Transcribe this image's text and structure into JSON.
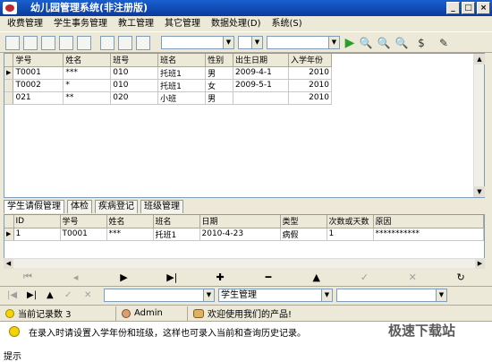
{
  "window": {
    "title": "幼儿园管理系统(非注册版)"
  },
  "menu": [
    {
      "label": "收费管理"
    },
    {
      "label": "学生事务管理"
    },
    {
      "label": "教工管理"
    },
    {
      "label": "其它管理"
    },
    {
      "label": "数据处理(D)"
    },
    {
      "label": "系统(S)"
    }
  ],
  "grid_main": {
    "headers": [
      "学号",
      "姓名",
      "班号",
      "班名",
      "性别",
      "出生日期",
      "入学年份"
    ],
    "rows": [
      {
        "xh": "T0001",
        "xm": "***",
        "bh": "010",
        "bm": "托班1",
        "xb": "男",
        "csrq": "2009-4-1",
        "rxnf": "2010",
        "current": true
      },
      {
        "xh": "T0002",
        "xm": "*",
        "bh": "010",
        "bm": "托班1",
        "xb": "女",
        "csrq": "2009-5-1",
        "rxnf": "2010",
        "current": false
      },
      {
        "xh": "021",
        "xm": "**",
        "bh": "020",
        "bm": "小班",
        "xb": "男",
        "csrq": "",
        "rxnf": "2010",
        "current": false
      }
    ]
  },
  "tabs": [
    {
      "label": "学生请假管理",
      "active": true
    },
    {
      "label": "体检",
      "active": false
    },
    {
      "label": "疾病登记",
      "active": false
    },
    {
      "label": "班级管理",
      "active": false
    }
  ],
  "grid_leave": {
    "headers": [
      "ID",
      "学号",
      "姓名",
      "班名",
      "日期",
      "类型",
      "次数或天数",
      "原因"
    ],
    "rows": [
      {
        "id": "1",
        "xh": "T0001",
        "xm": "***",
        "bm": "托班1",
        "rq": "2010-4-23",
        "lx": "病假",
        "cs": "1",
        "yy": "***********"
      }
    ]
  },
  "bottom": {
    "module_select": "学生管理"
  },
  "status": {
    "record_count": "当前记录数 3",
    "user": "Admin",
    "welcome": "欢迎使用我们的产品!"
  },
  "tip": {
    "text": "在录入时请设置入学年份和班级，这样也可录入当前和查询历史记录。",
    "label": "提示"
  },
  "watermark": "极速下载站",
  "colors": {
    "title_bar": "#0a3a9e",
    "accent_green": "#2a9e2a"
  }
}
